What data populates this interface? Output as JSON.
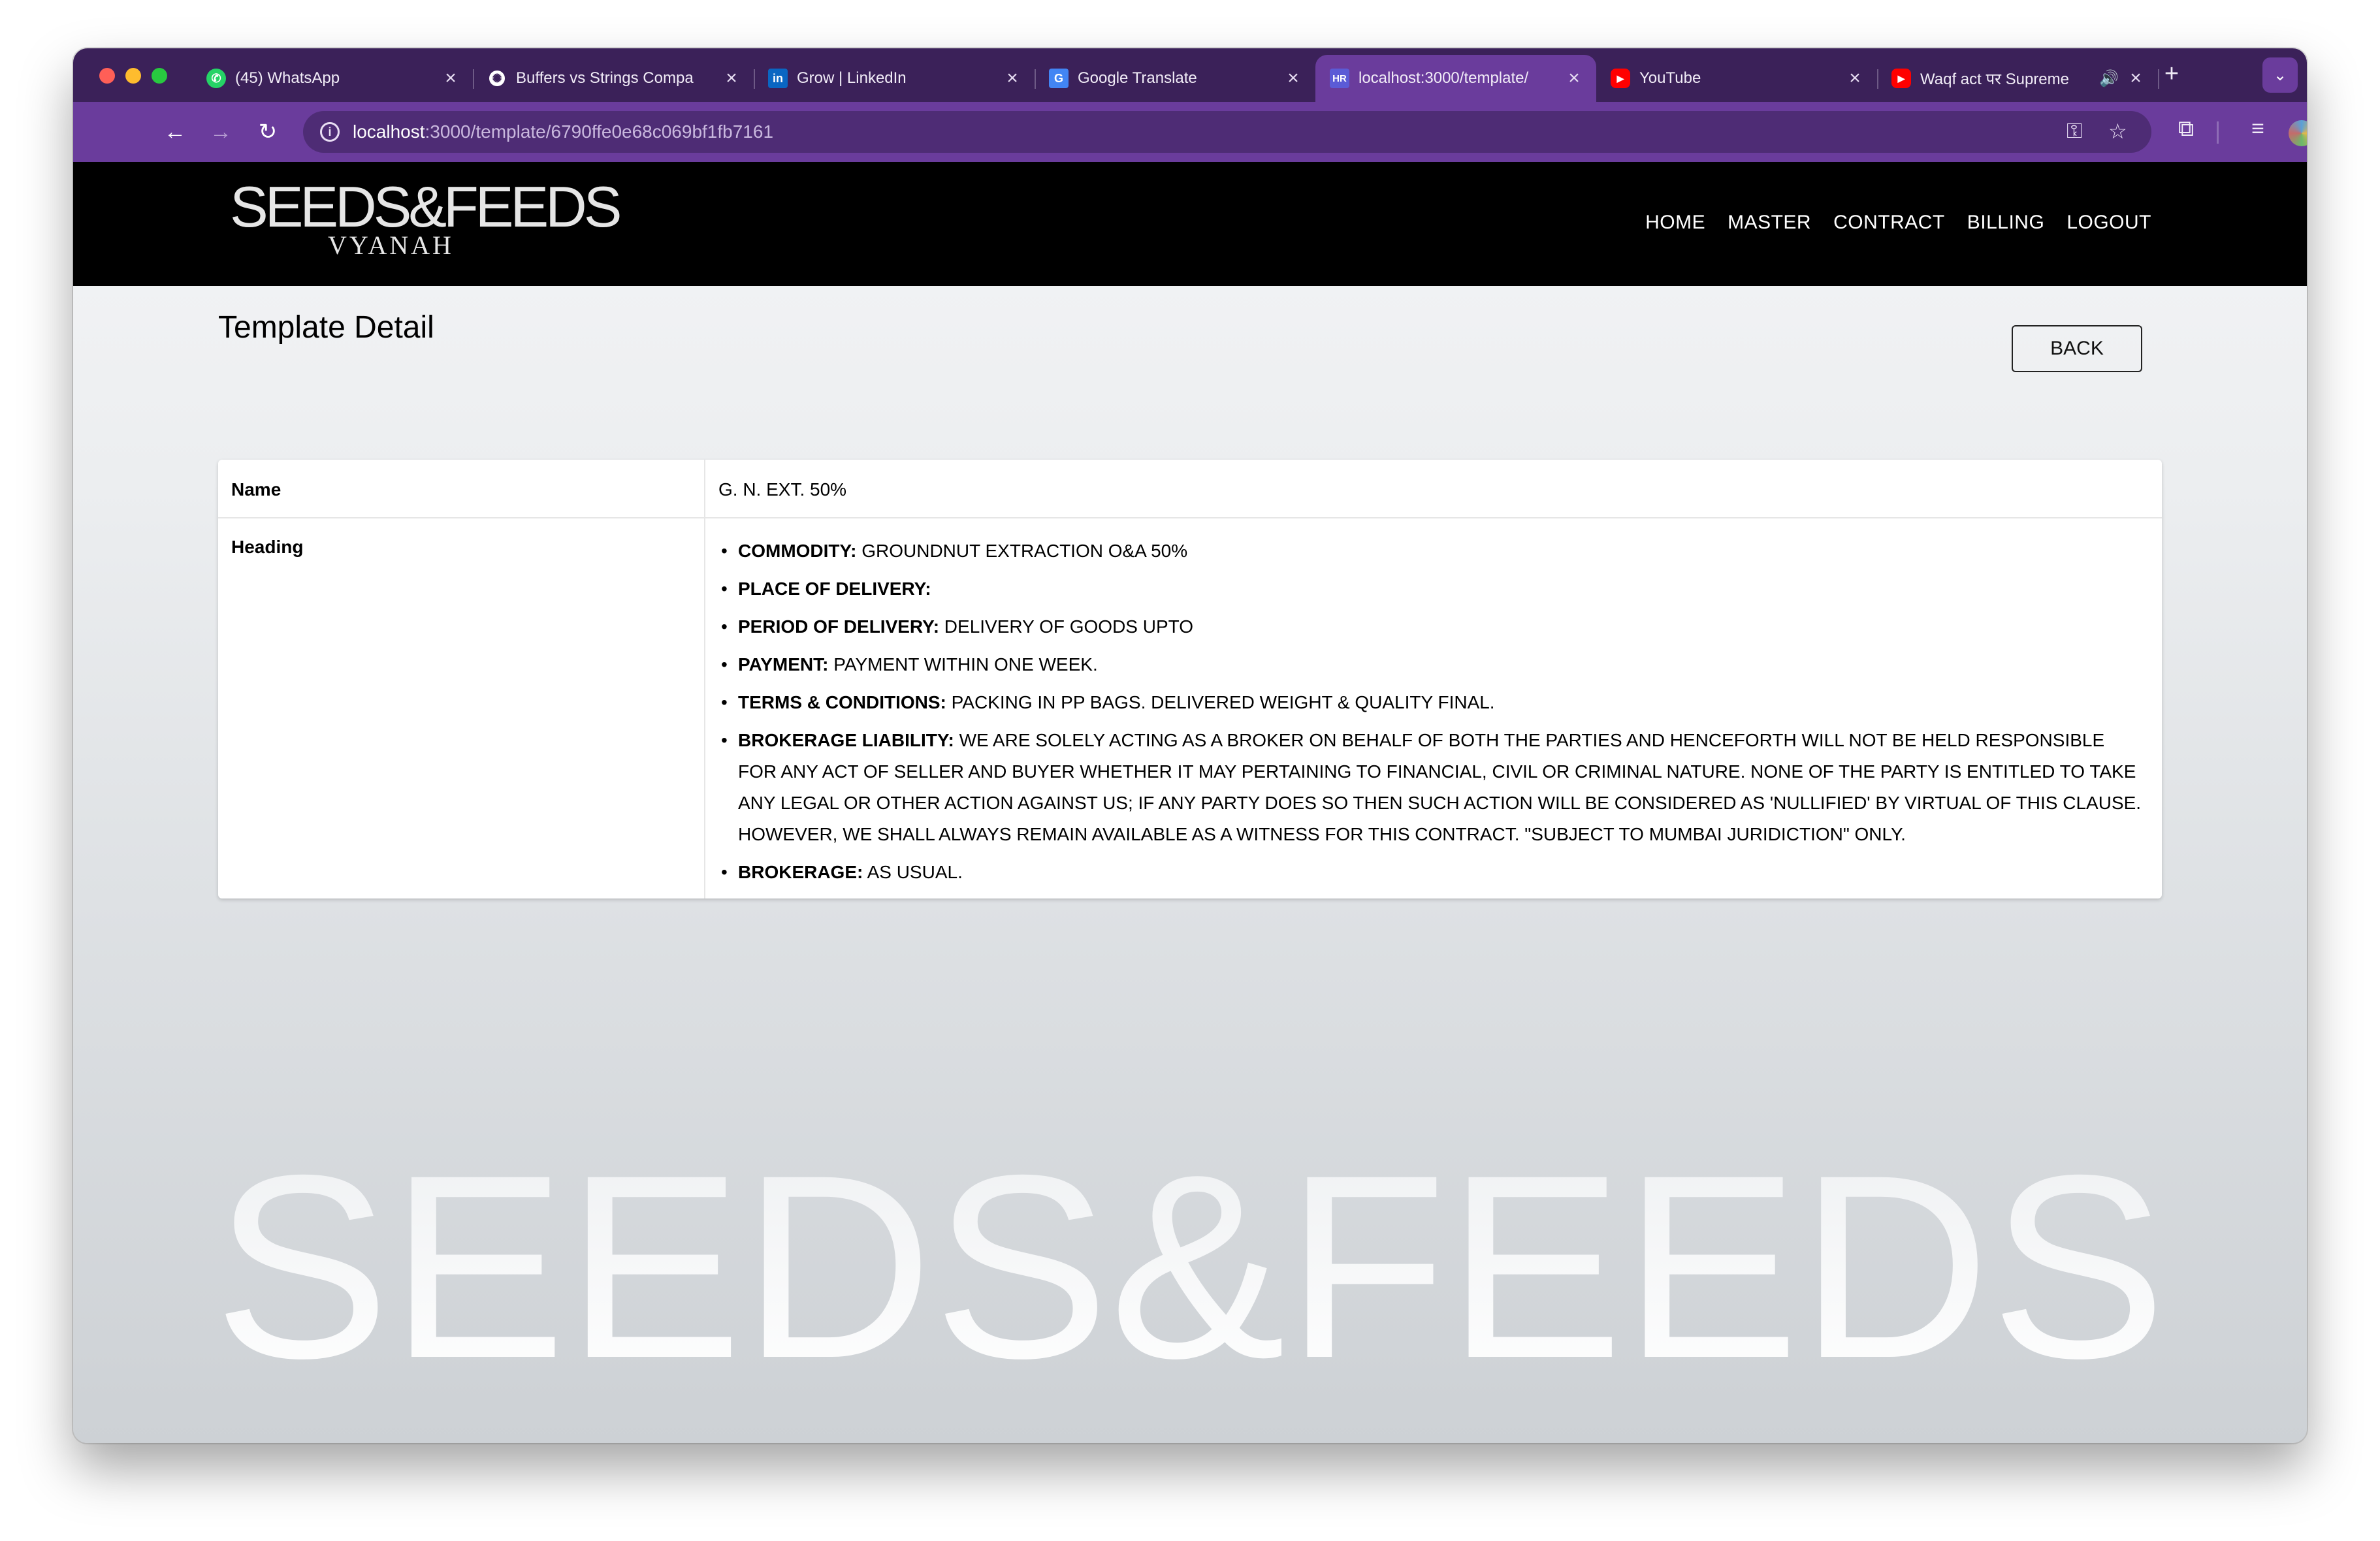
{
  "browser": {
    "tabs": [
      {
        "label": "(45) WhatsApp",
        "icon": "whatsapp-icon",
        "active": false
      },
      {
        "label": "Buffers vs Strings Compa",
        "icon": "openai-icon",
        "active": false
      },
      {
        "label": "Grow | LinkedIn",
        "icon": "linkedin-icon",
        "active": false
      },
      {
        "label": "Google Translate",
        "icon": "google-translate-icon",
        "active": false
      },
      {
        "label": "localhost:3000/template/",
        "icon": "hr-app-icon",
        "active": true
      },
      {
        "label": "YouTube",
        "icon": "youtube-icon",
        "active": false
      },
      {
        "label": "Waqf act पर Supreme",
        "icon": "youtube-icon",
        "active": false
      }
    ],
    "tab_icon_text": {
      "linkedin": "in",
      "translate": "G",
      "hr": "HR"
    },
    "url_host": "localhost",
    "url_path": ":3000/template/6790ffe0e68c069bf1fb7161",
    "new_tab_label": "+",
    "colors": {
      "tabstrip": "#3b2159",
      "toolbar": "#6a3c9c",
      "omnibox": "#4e2c75"
    }
  },
  "site": {
    "logo_main": "SEEDS&FEEDS",
    "logo_sub": "VYANAH",
    "nav": [
      "HOME",
      "MASTER",
      "CONTRACT",
      "BILLING",
      "LOGOUT"
    ],
    "watermark": "SEEDS&FEEDS"
  },
  "page": {
    "title": "Template Detail",
    "back_label": "BACK"
  },
  "detail": {
    "name_label": "Name",
    "name_value": "G. N. EXT. 50%",
    "heading_label": "Heading",
    "terms": [
      {
        "key": "COMMODITY:",
        "value": " GROUNDNUT EXTRACTION O&A 50%"
      },
      {
        "key": "PLACE OF DELIVERY:",
        "value": ""
      },
      {
        "key": "PERIOD OF DELIVERY:",
        "value": " DELIVERY OF GOODS UPTO"
      },
      {
        "key": "PAYMENT:",
        "value": " PAYMENT WITHIN ONE WEEK."
      },
      {
        "key": "TERMS & CONDITIONS:",
        "value": " PACKING IN PP BAGS. DELIVERED WEIGHT & QUALITY FINAL."
      },
      {
        "key": "BROKERAGE LIABILITY:",
        "value": " WE ARE SOLELY ACTING AS A BROKER ON BEHALF OF BOTH THE PARTIES AND HENCEFORTH WILL NOT BE HELD RESPONSIBLE FOR ANY ACT OF SELLER AND BUYER WHETHER IT MAY PERTAINING TO FINANCIAL, CIVIL OR CRIMINAL NATURE. NONE OF THE PARTY IS ENTITLED TO TAKE ANY LEGAL OR OTHER ACTION AGAINST US; IF ANY PARTY DOES SO THEN SUCH ACTION WILL BE CONSIDERED AS 'NULLIFIED' BY VIRTUAL OF THIS CLAUSE. HOWEVER, WE SHALL ALWAYS REMAIN AVAILABLE AS A WITNESS FOR THIS CONTRACT. \"SUBJECT TO MUMBAI JURIDICTION\" ONLY."
      },
      {
        "key": "BROKERAGE:",
        "value": " AS USUAL."
      }
    ]
  }
}
